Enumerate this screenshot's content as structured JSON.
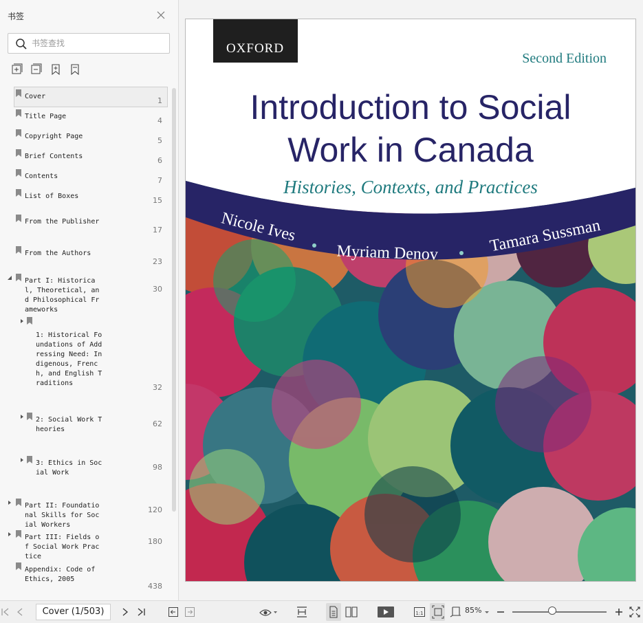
{
  "sidebar": {
    "title": "书签",
    "search_placeholder": "书签查找",
    "bookmarks": [
      {
        "label": "Cover",
        "page": "1",
        "selected": true
      },
      {
        "label": "Title Page",
        "page": "4"
      },
      {
        "label": "Copyright Page",
        "page": "5"
      },
      {
        "label": "Brief Contents",
        "page": "6"
      },
      {
        "label": "Contents",
        "page": "7"
      },
      {
        "label": "List of Boxes",
        "page": "15"
      },
      {
        "label": "From the Publisher",
        "page": "17"
      },
      {
        "label": "From the Authors",
        "page": "23"
      },
      {
        "label": "Part I: Historical, Theoretical, and Philosophical Frameworks",
        "page": "30",
        "expanded": true
      },
      {
        "label": "1: Historical Foundations of Addressing Need: Indigenous, French, and English Traditions",
        "page": "32",
        "child": true
      },
      {
        "label": "2: Social Work Theories",
        "page": "62",
        "child": true
      },
      {
        "label": "3: Ethics in Social Work",
        "page": "98",
        "child": true
      },
      {
        "label": "Part II: Foundational Skills for Social Workers",
        "page": "120"
      },
      {
        "label": "Part III: Fields of Social Work Practice",
        "page": "180"
      },
      {
        "label": "Appendix: Code of Ethics, 2005",
        "page": "438"
      }
    ]
  },
  "cover": {
    "publisher": "OXFORD",
    "edition": "Second Edition",
    "title_line1": "Introduction to Social",
    "title_line2": "Work in Canada",
    "subtitle": "Histories, Contexts, and Practices",
    "authors": [
      "Nicole Ives",
      "Myriam Denov",
      "Tamara Sussman"
    ],
    "colors": {
      "navy": "#272466",
      "teal": "#1f7a7e"
    }
  },
  "toolbar": {
    "page_indicator": "Cover (1/503)",
    "zoom": "85%",
    "zoom_fraction": 0.42
  }
}
